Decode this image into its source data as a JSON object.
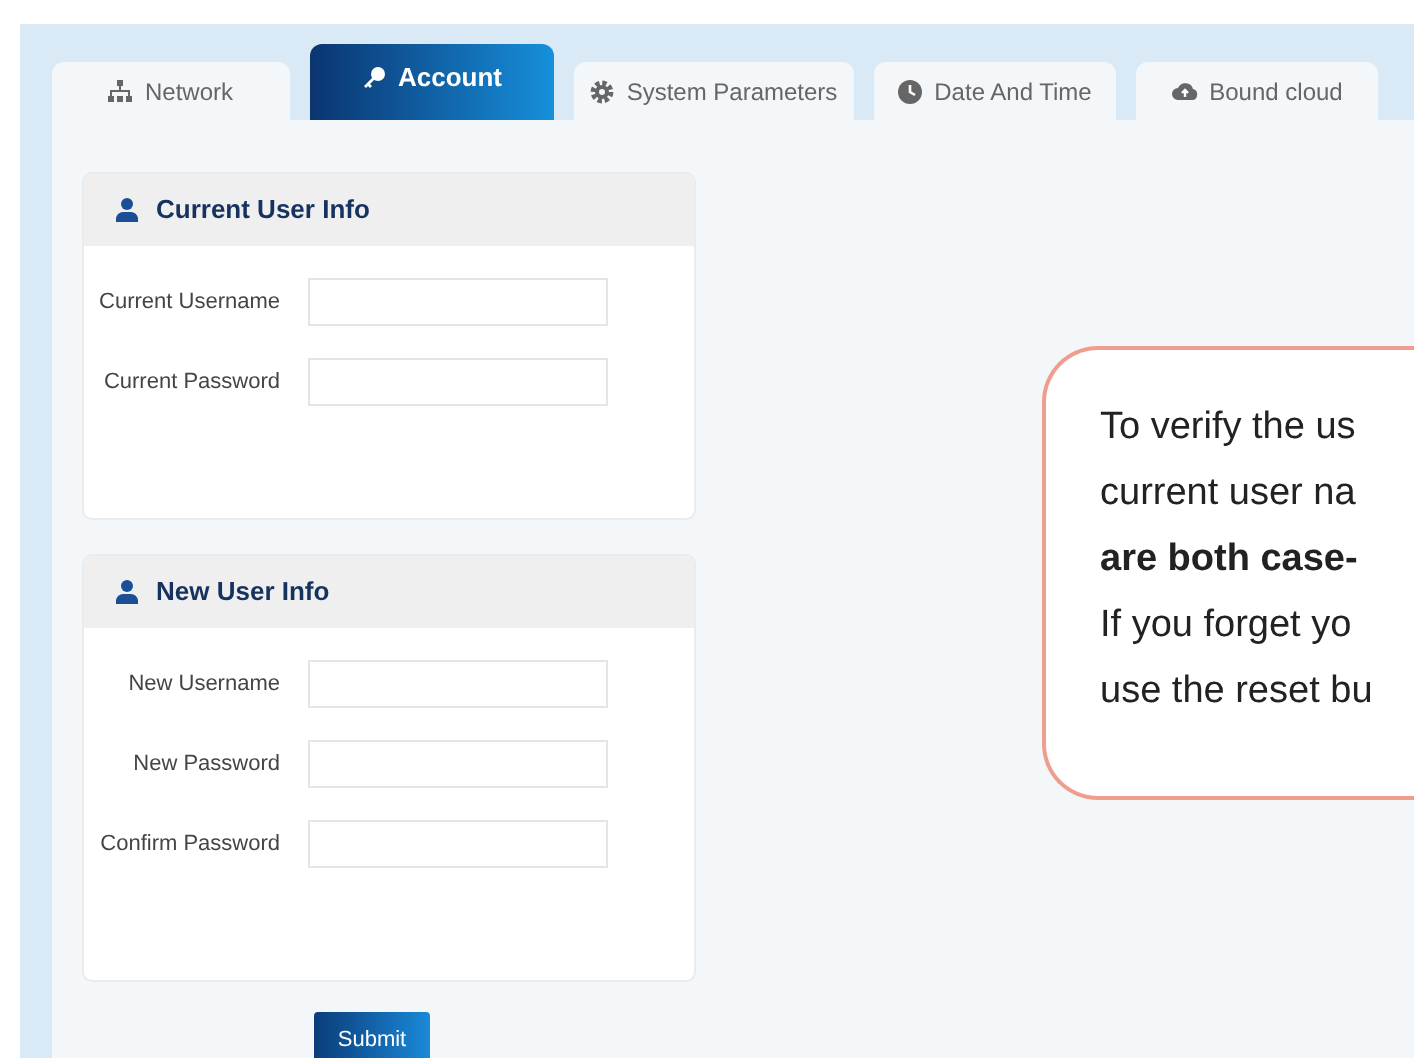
{
  "tabs": [
    {
      "label": "Network",
      "selected": false
    },
    {
      "label": "Account",
      "selected": true
    },
    {
      "label": "System Parameters",
      "selected": false
    },
    {
      "label": "Date And Time",
      "selected": false
    },
    {
      "label": "Bound cloud",
      "selected": false
    }
  ],
  "panels": [
    {
      "title": "Current User Info",
      "fields": [
        {
          "label": "Current Username"
        },
        {
          "label": "Current Password"
        }
      ]
    },
    {
      "title": "New User Info",
      "fields": [
        {
          "label": "New Username"
        },
        {
          "label": "New Password"
        },
        {
          "label": "Confirm Password"
        }
      ]
    }
  ],
  "submit": "Submit",
  "note": [
    {
      "text": "To verify the us",
      "bold": false
    },
    {
      "text": "current user na",
      "bold": false
    },
    {
      "text": "are both case-",
      "bold": true
    },
    {
      "text": "If you forget yo",
      "bold": false
    },
    {
      "text": "use the reset bu",
      "bold": false
    }
  ]
}
